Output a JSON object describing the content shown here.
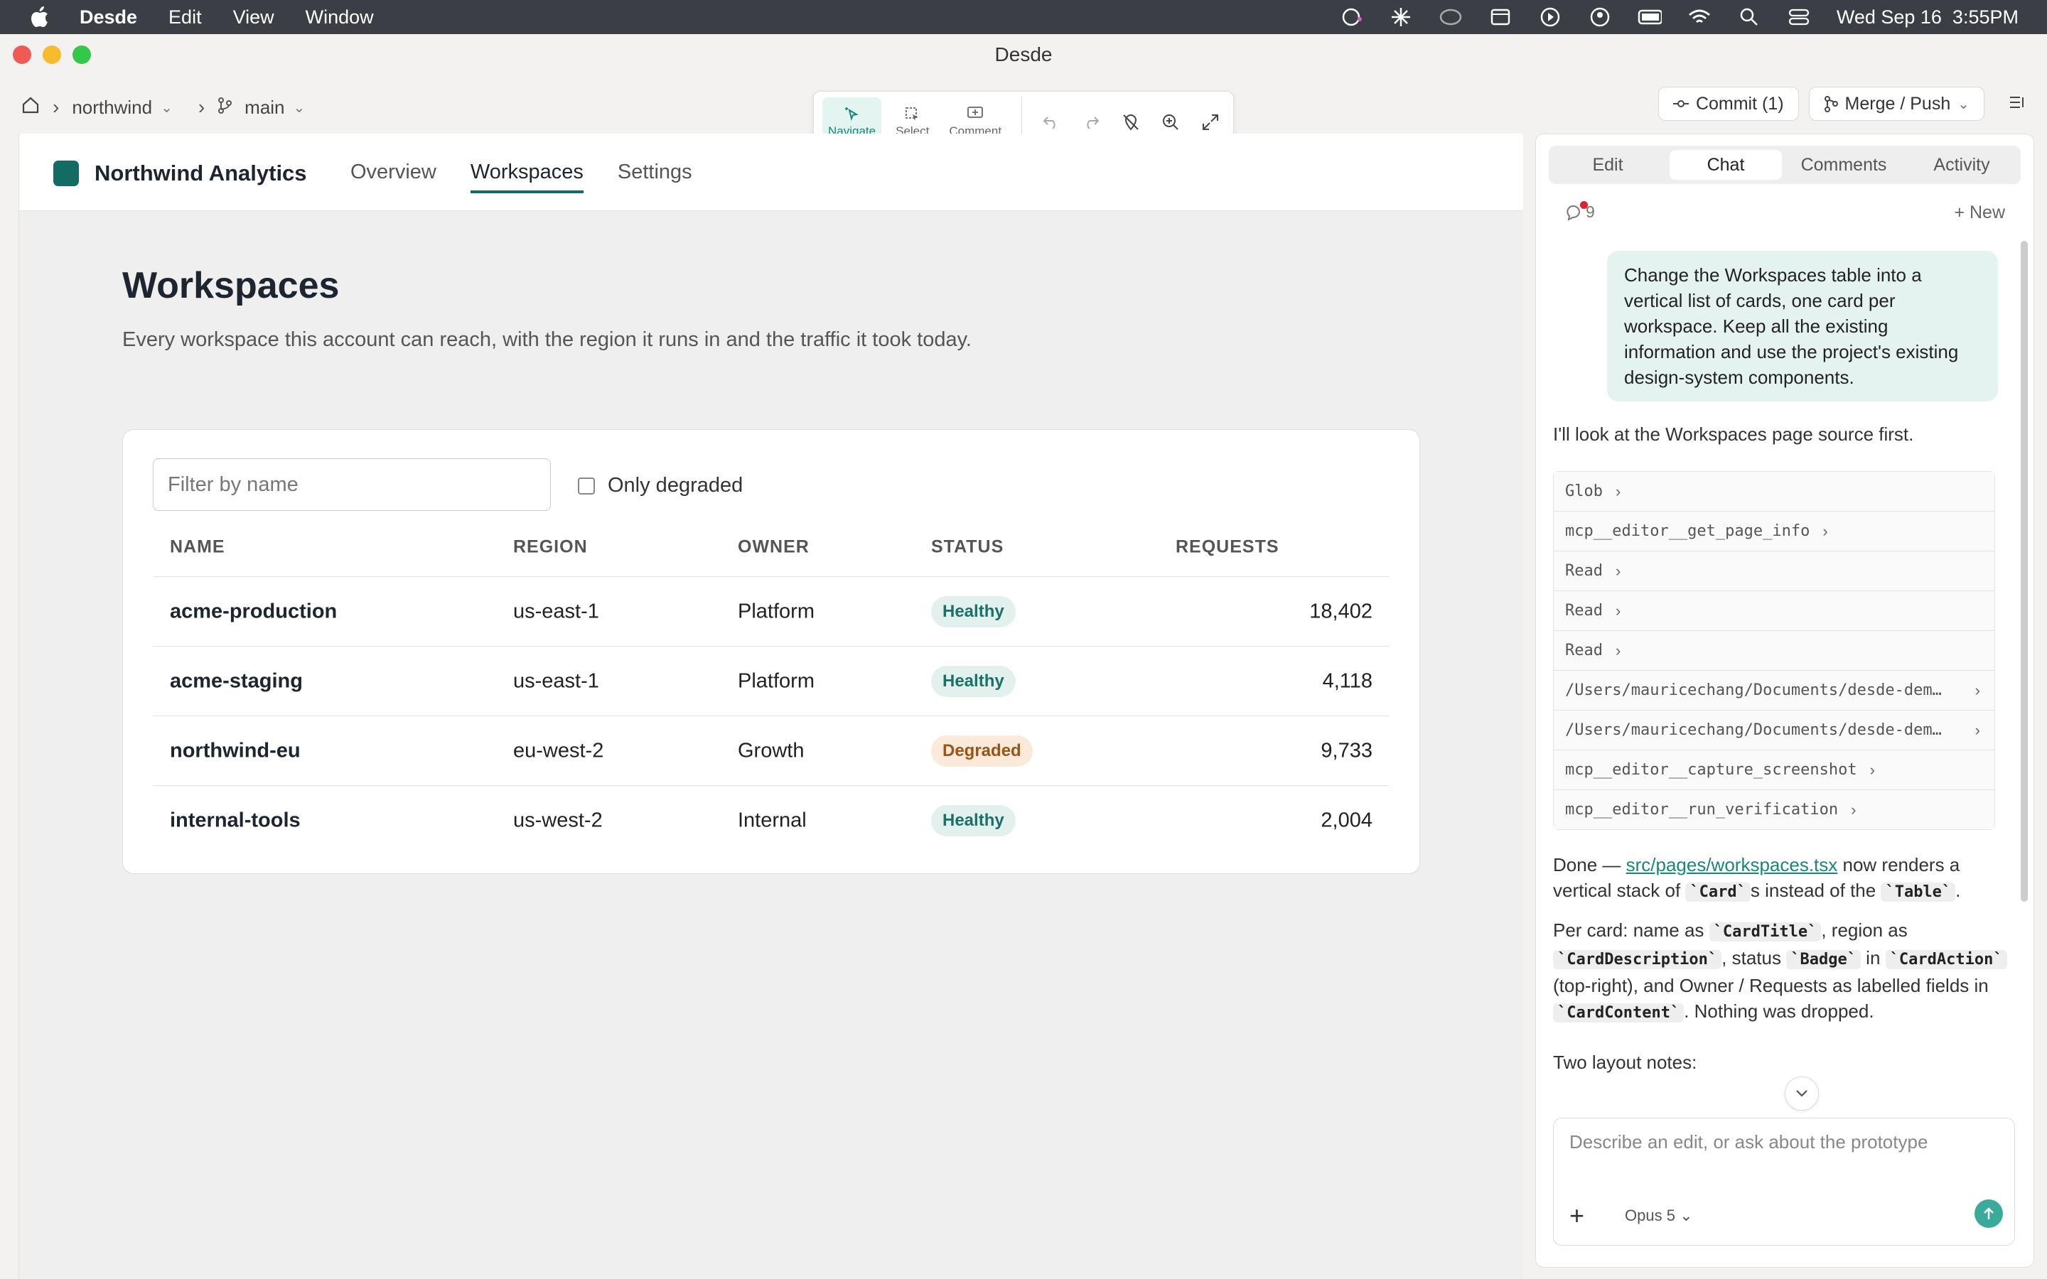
{
  "menubar": {
    "app_name": "Desde",
    "menus": [
      "Edit",
      "View",
      "Window"
    ],
    "clock": "Wed Sep 16  3:55PM"
  },
  "window": {
    "title": "Desde"
  },
  "toolbar": {
    "project": "northwind",
    "branch": "main",
    "tools": {
      "navigate": "Navigate",
      "select": "Select",
      "comment": "Comment"
    },
    "commit_label": "Commit (1)",
    "merge_label": "Merge / Push"
  },
  "app": {
    "brand": "Northwind Analytics",
    "tabs": [
      "Overview",
      "Workspaces",
      "Settings"
    ],
    "page_title": "Workspaces",
    "page_subtitle": "Every workspace this account can reach, with the region it runs in and the traffic it took today.",
    "filter_placeholder": "Filter by name",
    "only_degraded_label": "Only degraded",
    "columns": [
      "NAME",
      "REGION",
      "OWNER",
      "STATUS",
      "REQUESTS"
    ],
    "rows": [
      {
        "name": "acme-production",
        "region": "us-east-1",
        "owner": "Platform",
        "status": "Healthy",
        "requests": "18,402"
      },
      {
        "name": "acme-staging",
        "region": "us-east-1",
        "owner": "Platform",
        "status": "Healthy",
        "requests": "4,118"
      },
      {
        "name": "northwind-eu",
        "region": "eu-west-2",
        "owner": "Growth",
        "status": "Degraded",
        "requests": "9,733"
      },
      {
        "name": "internal-tools",
        "region": "us-west-2",
        "owner": "Internal",
        "status": "Healthy",
        "requests": "2,004"
      }
    ],
    "colors": {
      "accent": "#146b63",
      "healthy_bg": "#e2f1ee",
      "degraded_bg": "#fbe9d9"
    }
  },
  "panel": {
    "tabs": [
      "Edit",
      "Chat",
      "Comments",
      "Activity"
    ],
    "active_tab": "Chat",
    "thread_count": "9",
    "new_label": "+ New",
    "user_message": "Change the Workspaces table into a vertical list of cards, one card per workspace. Keep all the existing information and use the project's existing design-system components.",
    "assistant_intro": "I'll look at the Workspaces page source first.",
    "tool_calls": [
      "Glob",
      "mcp__editor__get_page_info",
      "Read",
      "Read",
      "Read",
      "/Users/mauricechang/Documents/desde-dem…",
      "/Users/mauricechang/Documents/desde-dem…",
      "mcp__editor__capture_screenshot",
      "mcp__editor__run_verification"
    ],
    "done": {
      "prefix": "Done — ",
      "link": "src/pages/workspaces.tsx",
      "mid": " now renders a vertical stack of ",
      "code1": "`Card`",
      "mid2": "s instead of the ",
      "code2": "`Table`",
      "end": "."
    },
    "percard": {
      "t1": "Per card: name as ",
      "c1": "`CardTitle`",
      "t2": ", region as ",
      "c2": "`CardDescription`",
      "t3": ", status ",
      "c3": "`Badge`",
      "t4": " in ",
      "c4": "`CardAction`",
      "t5": " (top-right), and Owner / Requests as labelled fields in ",
      "c5": "`CardContent`",
      "t6": ". Nothing was dropped."
    },
    "layout_notes": "Two layout notes:",
    "composer_placeholder": "Describe an edit, or ask about the prototype",
    "model": "Opus 5"
  }
}
